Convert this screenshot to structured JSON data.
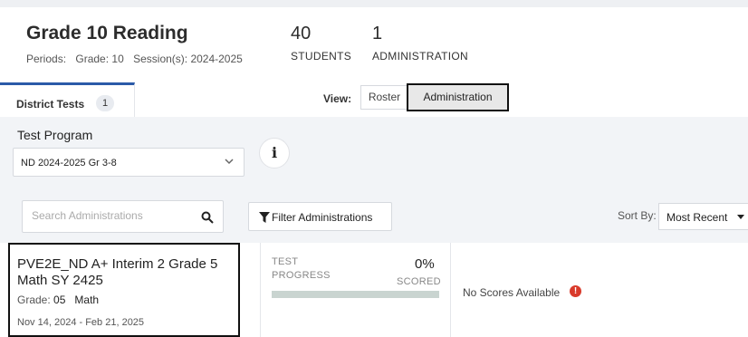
{
  "header": {
    "title": "Grade 10 Reading",
    "periods_label": "Periods:",
    "grade_label": "Grade: 10",
    "session_label": "Session(s): 2024-2025",
    "students_count": "40",
    "students_label": "STUDENTS",
    "admins_count": "1",
    "admins_label": "ADMINISTRATION"
  },
  "tabs": {
    "district_label": "District Tests",
    "district_count": "1"
  },
  "view": {
    "label": "View:",
    "options": [
      "Roster",
      "Administration"
    ],
    "selected": "Administration"
  },
  "test_program": {
    "label": "Test Program",
    "selected": "ND 2024-2025 Gr 3-8",
    "info_icon": "info-icon"
  },
  "toolbar": {
    "search_placeholder": "Search Administrations",
    "filter_label": "Filter Administrations",
    "sort_label": "Sort By:",
    "sort_value": "Most Recent"
  },
  "administration": {
    "title": "PVE2E_ND A+ Interim 2 Grade 5 Math SY 2425",
    "grade_label": "Grade:",
    "grade_value": "05",
    "subject": "Math",
    "dates": "Nov 14, 2024 - Feb 21, 2025",
    "progress_label": "TEST PROGRESS",
    "progress_pct": "0%",
    "progress_value": 0,
    "scored_label": "SCORED",
    "no_scores": "No Scores Available"
  },
  "colors": {
    "accent": "#2b5aa8",
    "alert": "#d93a2b",
    "progress_track": "#c9d4d0",
    "background": "#f2f4f7"
  }
}
